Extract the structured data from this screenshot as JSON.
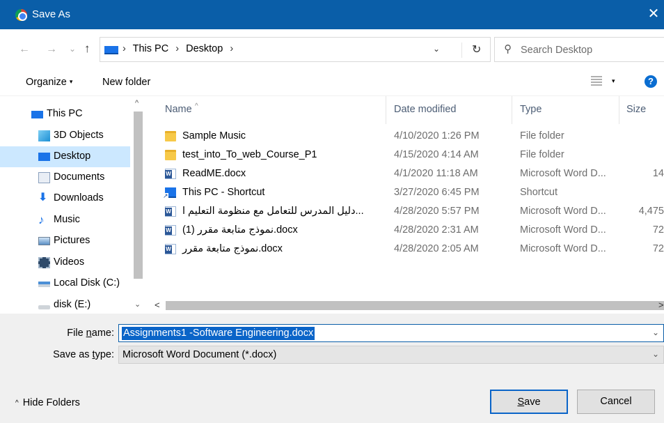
{
  "window": {
    "title": "Save As",
    "close_glyph": "✕",
    "app_icon": "chrome-icon"
  },
  "nav": {
    "back": "←",
    "forward": "→",
    "recent": "⌄",
    "up": "↑"
  },
  "address": {
    "crumbs": [
      "This PC",
      "Desktop"
    ],
    "separator": "›",
    "dropdown_glyph": "⌄",
    "refresh_glyph": "↻"
  },
  "search": {
    "placeholder": "Search Desktop",
    "icon": "⚲"
  },
  "toolbar": {
    "organize_label": "Organize",
    "organize_caret": "▾",
    "new_folder_label": "New folder",
    "view_caret": "▾",
    "help_label": "?"
  },
  "sidebar": {
    "items": [
      {
        "label": "This PC",
        "icon": "this-pc-icon"
      },
      {
        "label": "3D Objects",
        "icon": "3d-objects-icon"
      },
      {
        "label": "Desktop",
        "icon": "desktop-icon",
        "selected": true
      },
      {
        "label": "Documents",
        "icon": "documents-icon"
      },
      {
        "label": "Downloads",
        "icon": "downloads-icon"
      },
      {
        "label": "Music",
        "icon": "music-icon"
      },
      {
        "label": "Pictures",
        "icon": "pictures-icon"
      },
      {
        "label": "Videos",
        "icon": "videos-icon"
      },
      {
        "label": "Local Disk (C:)",
        "icon": "local-disk-icon"
      },
      {
        "label": "disk (E:)",
        "icon": "disk-icon"
      }
    ],
    "scroll_up": "^",
    "scroll_down": "⌄"
  },
  "columns": {
    "name": "Name",
    "date": "Date modified",
    "type": "Type",
    "size": "Size",
    "sort_glyph": "^"
  },
  "files": [
    {
      "name": "Sample Music",
      "date": "4/10/2020 1:26 PM",
      "type": "File folder",
      "size": "",
      "icon": "folder-icon"
    },
    {
      "name": "test_into_To_web_Course_P1",
      "date": "4/15/2020 4:14 AM",
      "type": "File folder",
      "size": "",
      "icon": "folder-icon"
    },
    {
      "name": "ReadME.docx",
      "date": "4/1/2020 11:18 AM",
      "type": "Microsoft Word D...",
      "size": "14",
      "icon": "word-document-icon"
    },
    {
      "name": "This PC - Shortcut",
      "date": "3/27/2020 6:45 PM",
      "type": "Shortcut",
      "size": "",
      "icon": "shortcut-icon"
    },
    {
      "name": "دليل المدرس للتعامل مع منظومة التعليم ا...",
      "date": "4/28/2020 5:57 PM",
      "type": "Microsoft Word D...",
      "size": "4,475",
      "icon": "word-document-icon"
    },
    {
      "name": "نموذج متابعة مقرر (1).docx",
      "date": "4/28/2020 2:31 AM",
      "type": "Microsoft Word D...",
      "size": "72",
      "icon": "word-document-icon"
    },
    {
      "name": "نموذج متابعة مقرر.docx",
      "date": "4/28/2020 2:05 AM",
      "type": "Microsoft Word D...",
      "size": "72",
      "icon": "word-document-icon"
    }
  ],
  "hscroll": {
    "left": "<",
    "right": ">"
  },
  "form": {
    "file_name_label_pre": "File ",
    "file_name_label_u": "n",
    "file_name_label_post": "ame:",
    "file_name_value": "Assignments1 -Software Engineering.docx",
    "save_type_label_pre": "Save as ",
    "save_type_label_u": "t",
    "save_type_label_post": "ype:",
    "save_type_value": "Microsoft Word Document (*.docx)",
    "dropdown_glyph": "⌄"
  },
  "footer": {
    "hide_folders_caret": "^",
    "hide_folders_label": "Hide Folders",
    "save_u": "S",
    "save_rest": "ave",
    "cancel_label": "Cancel"
  },
  "colors": {
    "titlebar": "#0a5ea8",
    "selected_row": "#cce8ff",
    "accent": "#0a64c8"
  }
}
